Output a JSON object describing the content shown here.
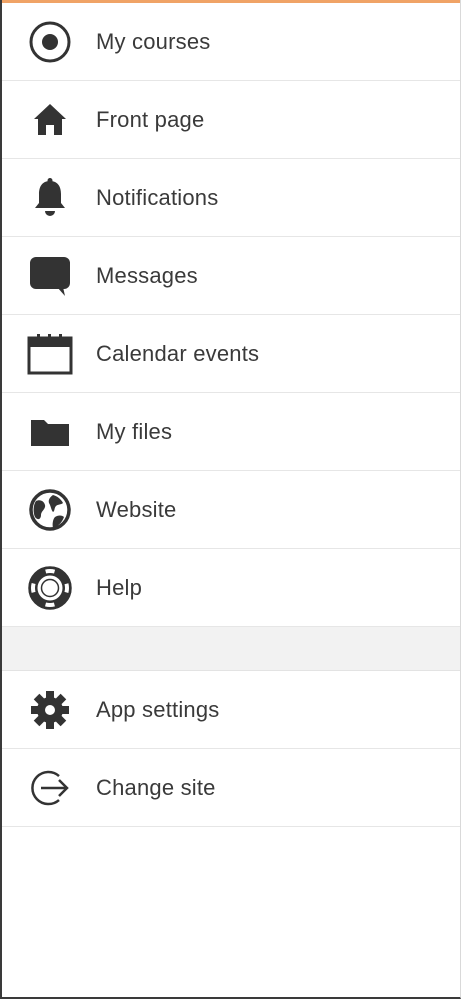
{
  "menu": {
    "accent_color": "#f0a366",
    "items": [
      {
        "label": "My courses",
        "icon": "target-icon"
      },
      {
        "label": "Front page",
        "icon": "home-icon"
      },
      {
        "label": "Notifications",
        "icon": "bell-icon"
      },
      {
        "label": "Messages",
        "icon": "chat-bubble-icon"
      },
      {
        "label": "Calendar events",
        "icon": "calendar-icon"
      },
      {
        "label": "My files",
        "icon": "folder-icon"
      },
      {
        "label": "Website",
        "icon": "globe-icon"
      },
      {
        "label": "Help",
        "icon": "lifebuoy-icon"
      }
    ],
    "secondary_items": [
      {
        "label": "App settings",
        "icon": "gear-icon"
      },
      {
        "label": "Change site",
        "icon": "sign-out-icon"
      }
    ]
  }
}
